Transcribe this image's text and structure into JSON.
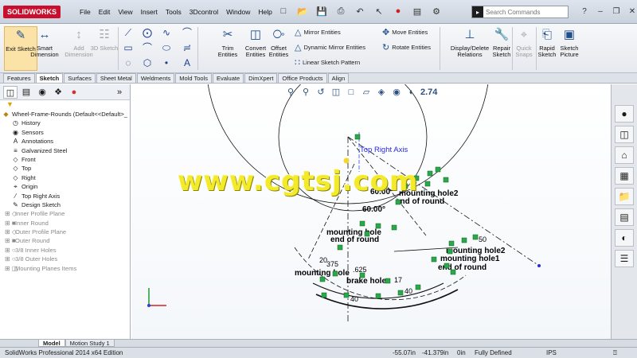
{
  "app": {
    "logo": "SOLIDWORKS"
  },
  "menu": [
    "File",
    "Edit",
    "View",
    "Insert",
    "Tools",
    "3Dcontrol",
    "Window",
    "Help"
  ],
  "search": {
    "placeholder": "Search Commands"
  },
  "commands": {
    "exit_sketch": "Exit Sketch",
    "smart_dimension": "Smart Dimension",
    "add_dimension": "Add Dimension",
    "sketch_3d": "3D Sketch",
    "trim_entities": "Trim Entities",
    "convert_entities": "Convert Entities",
    "offset_entities": "Offset Entities",
    "mirror_entities": "Mirror Entities",
    "dynamic_mirror": "Dynamic Mirror Entities",
    "linear_pattern": "Linear Sketch Pattern",
    "move_entities": "Move Entities",
    "rotate_entities": "Rotate Entities",
    "display_relations": "Display/Delete Relations",
    "repair_sketch": "Repair Sketch",
    "quick_snaps": "Quick Snaps",
    "rapid_sketch": "Rapid Sketch",
    "sketch_picture": "Sketch Picture"
  },
  "tabs": [
    "Features",
    "Sketch",
    "Surfaces",
    "Sheet Metal",
    "Weldments",
    "Mold Tools",
    "Evaluate",
    "DimXpert",
    "Office Products",
    "Align"
  ],
  "active_tab": "Sketch",
  "tree": {
    "root": "Wheel-Frame-Rounds  (Default<<Default>_",
    "items": [
      {
        "label": "History",
        "grey": false
      },
      {
        "label": "Sensors",
        "grey": false
      },
      {
        "label": "Annotations",
        "grey": false
      },
      {
        "label": "Galvanized Steel",
        "grey": false
      },
      {
        "label": "Front",
        "grey": false
      },
      {
        "label": "Top",
        "grey": false
      },
      {
        "label": "Right",
        "grey": false
      },
      {
        "label": "Origin",
        "grey": false
      },
      {
        "label": "Top Right Axis",
        "grey": false
      },
      {
        "label": "Design Sketch",
        "grey": false
      },
      {
        "label": "Inner Profile Plane",
        "grey": true
      },
      {
        "label": "Inner Round",
        "grey": true
      },
      {
        "label": "Outer Profile Plane",
        "grey": true
      },
      {
        "label": "Outer Round",
        "grey": true
      },
      {
        "label": "3/8 Inner Holes",
        "grey": true
      },
      {
        "label": "3/8 Outer Holes",
        "grey": true
      },
      {
        "label": "Mounting Planes Items",
        "grey": true
      }
    ]
  },
  "graphics": {
    "axis_label": "Top Right Axis",
    "dim_a": "60.00°",
    "dim_b": "60.00°",
    "dim_c": "2.74",
    "labels": {
      "mounting_hole2_a": "mounting hole2",
      "end_of_round_a": "end of round",
      "mounting_hole_a": "mounting hole",
      "end_of_round_b": "end of round",
      "mounting_hole2_b": "mounting hole2",
      "mounting_hole1": "mounting hole1",
      "end_of_round_c": "end of round",
      "mounting_hole_c": "mounting hole",
      "brake_hole": "brake hole",
      "dim_375": "375",
      "dim_625": ".625",
      "dim_20": "20",
      "dim_50": "50",
      "dim_40a": "40",
      "dim_40b": "40",
      "dim_17": "17"
    },
    "watermark": "www.cgtsj.com"
  },
  "bottom_tabs": [
    "Model",
    "Motion Study 1"
  ],
  "status": {
    "edition": "SolidWorks Professional 2014 x64 Edition",
    "x": "-55.07in",
    "y": "-41.379in",
    "z": "0in",
    "state": "Fully Defined",
    "units": "IPS"
  }
}
